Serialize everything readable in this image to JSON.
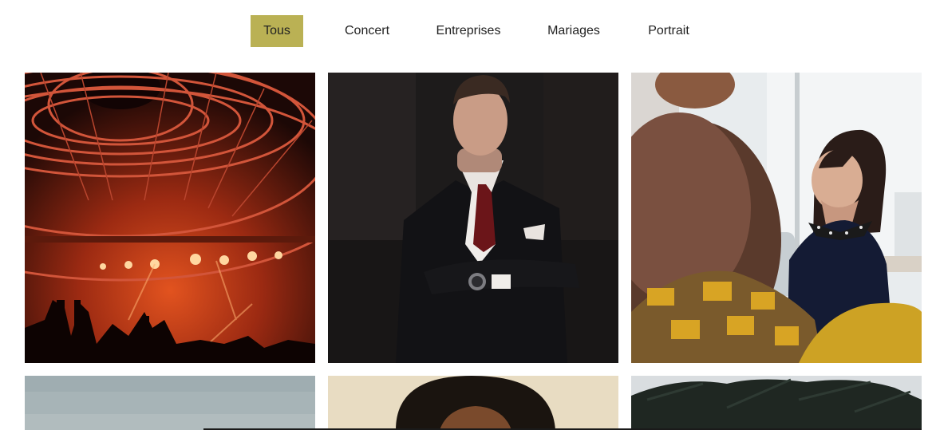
{
  "filters": [
    {
      "label": "Tous",
      "active": true
    },
    {
      "label": "Concert",
      "active": false
    },
    {
      "label": "Entreprises",
      "active": false
    },
    {
      "label": "Mariages",
      "active": false
    },
    {
      "label": "Portrait",
      "active": false
    }
  ],
  "colors": {
    "active_filter_bg": "#bab154",
    "text": "#222222",
    "background": "#ffffff"
  },
  "gallery": [
    {
      "subject": "concert-stage-photo"
    },
    {
      "subject": "businessman-portrait-photo"
    },
    {
      "subject": "office-meeting-photo"
    },
    {
      "subject": "sky-photo"
    },
    {
      "subject": "person-portrait-photo"
    },
    {
      "subject": "palm-tree-photo"
    }
  ]
}
